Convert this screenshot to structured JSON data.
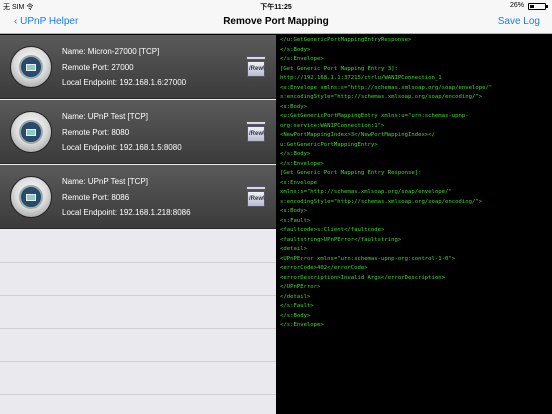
{
  "status": {
    "carrier": "无 SIM 令",
    "time": "下午11:25",
    "battery": "26%"
  },
  "nav": {
    "back_label": "UPnP Helper",
    "title": "Remove Port Mapping",
    "save_label": "Save Log"
  },
  "mappings": [
    {
      "name": "Name: Micron-27000 [TCP]",
      "remote": "Remote Port: 27000",
      "endpoint": "Local Endpoint: 192.168.1.6:27000"
    },
    {
      "name": "Name: UPnP Test [TCP]",
      "remote": "Remote Port: 8080",
      "endpoint": "Local Endpoint: 192.168.1.5:8080"
    },
    {
      "name": "Name: UPnP Test [TCP]",
      "remote": "Remote Port: 8086",
      "endpoint": "Local Endpoint: 192.168.1.218:8086"
    }
  ],
  "trash_label": "/Rew\\",
  "log": [
    "</u:GetGenericPortMappingEntryResponse>",
    "</s:Body>",
    "</s:Envelope>",
    "",
    "[Get Generic Port Mapping Entry 3]:",
    "http://192.168.1.1:37215/ctrlu/WANIPConnection_1",
    "<s:Envelope xmlns:s=\"http://schemas.xmlsoap.org/soap/envelope/\"",
    "s:encodingStyle=\"http://schemas.xmlsoap.org/soap/encoding/\">",
    "<s:Body>",
    "<u:GetGenericPortMappingEntry xmlns:u=\"urn:schemas-upnp-",
    "org:service:WANIPConnection:1\">",
    "<NewPortMappingIndex>3</NewPortMappingIndex></",
    "u:GetGenericPortMappingEntry>",
    "</s:Body>",
    "</s:Envelope>",
    "",
    "[Get Generic Port Mapping Entry Response]:",
    "<s:Envelope",
    "xmlns:s=\"http://schemas.xmlsoap.org/soap/envelope/\"",
    "s:encodingStyle=\"http://schemas.xmlsoap.org/soap/encoding/\">",
    "<s:Body>",
    "<s:Fault>",
    "<faultcode>s:Client</faultcode>",
    "<faultstring>UPnPError</faultstring>",
    "<detail>",
    "<UPnPError xmlns=\"urn:schemas-upnp-org:control-1-0\">",
    "<errorCode>402</errorCode>",
    "<errorDescription>Invalid Args</errorDescription>",
    "</UPnPError>",
    "</detail>",
    "</s:Fault>",
    "</s:Body>",
    "</s:Envelope>"
  ]
}
